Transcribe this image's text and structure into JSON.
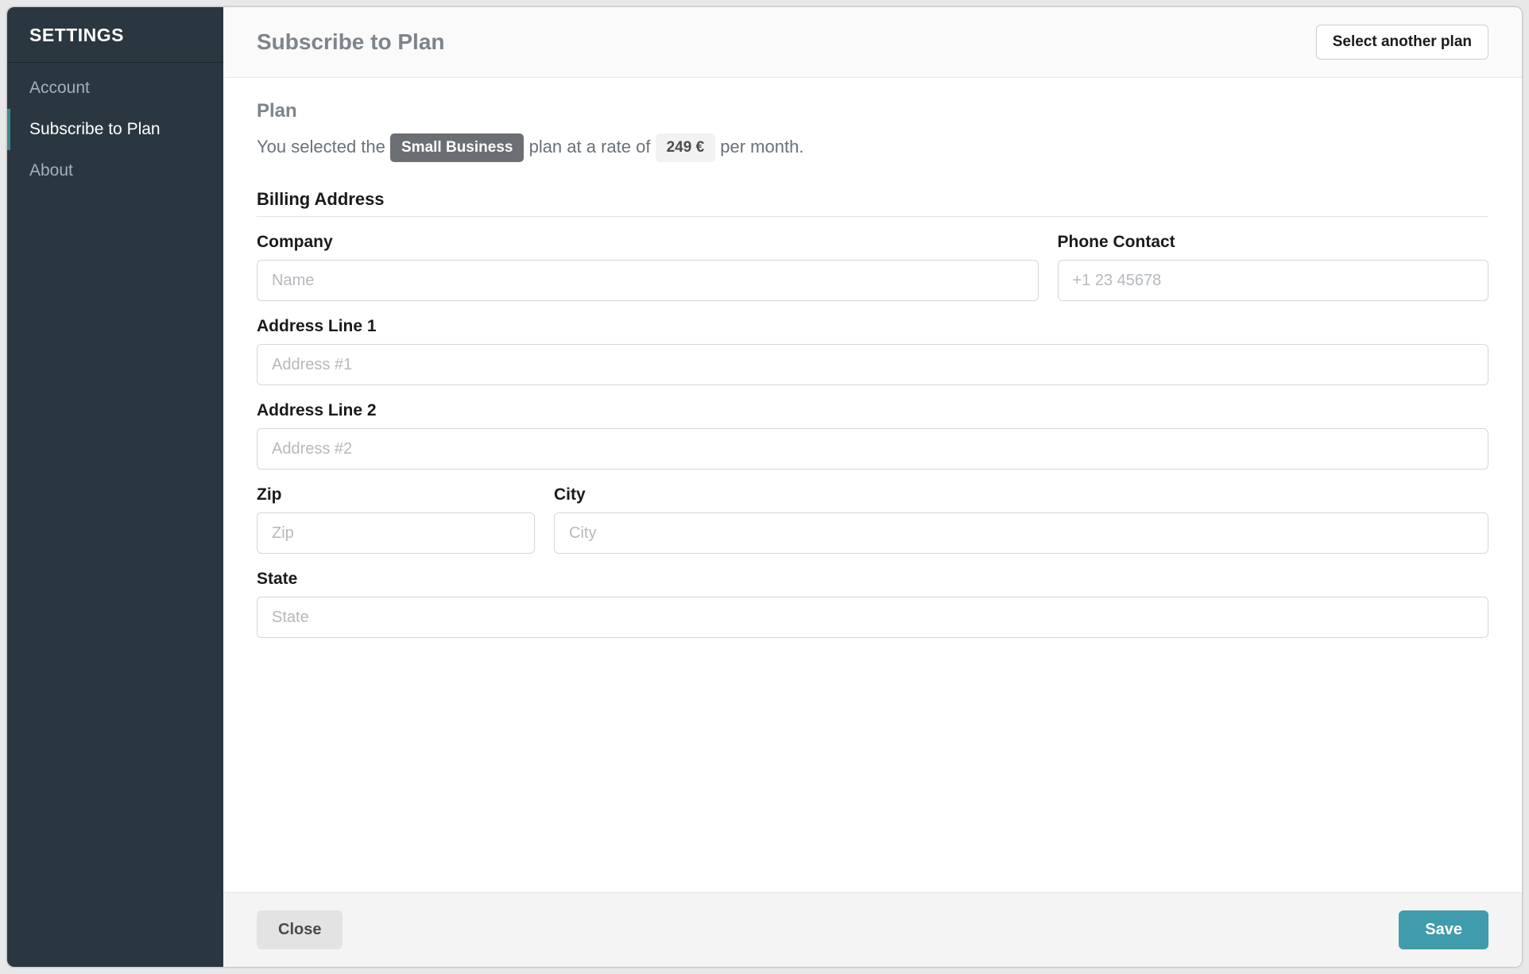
{
  "sidebar": {
    "title": "SETTINGS",
    "items": [
      {
        "label": "Account",
        "active": false
      },
      {
        "label": "Subscribe to Plan",
        "active": true
      },
      {
        "label": "About",
        "active": false
      }
    ]
  },
  "header": {
    "title": "Subscribe to Plan",
    "select_another_label": "Select another plan"
  },
  "plan": {
    "section_title": "Plan",
    "text_before": "You selected the",
    "plan_name": "Small Business",
    "text_mid": "plan at a rate of",
    "rate": "249 €",
    "text_after": "per month."
  },
  "billing": {
    "section_title": "Billing Address",
    "fields": {
      "company": {
        "label": "Company",
        "placeholder": "Name",
        "value": ""
      },
      "phone": {
        "label": "Phone Contact",
        "placeholder": "+1 23 45678",
        "value": ""
      },
      "address1": {
        "label": "Address Line 1",
        "placeholder": "Address #1",
        "value": ""
      },
      "address2": {
        "label": "Address Line 2",
        "placeholder": "Address #2",
        "value": ""
      },
      "zip": {
        "label": "Zip",
        "placeholder": "Zip",
        "value": ""
      },
      "city": {
        "label": "City",
        "placeholder": "City",
        "value": ""
      },
      "state": {
        "label": "State",
        "placeholder": "State",
        "value": ""
      }
    }
  },
  "footer": {
    "close_label": "Close",
    "save_label": "Save"
  }
}
